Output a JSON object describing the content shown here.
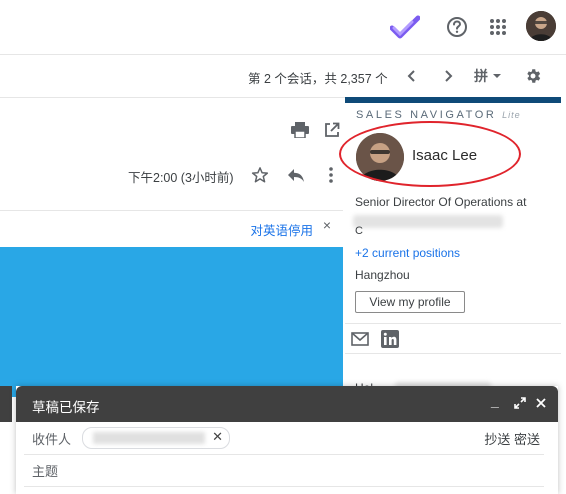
{
  "header": {
    "icons": [
      "tasks-check-icon",
      "help-icon",
      "apps-grid-icon",
      "account-avatar-icon"
    ]
  },
  "toolbar": {
    "count_text": "第 2 个会话，共 2,357 个",
    "input_tool_label": "拼"
  },
  "message": {
    "time_text": "下午2:00 (3小时前)",
    "translate_off_label": "对英语停用"
  },
  "sales_navigator": {
    "brand": "SALES NAVIGATOR",
    "tier": "Lite",
    "name": "Isaac Lee",
    "title_line": "Senior Director Of Operations at",
    "title_line2_suffix": "C",
    "positions_link": "+2 current positions",
    "location": "Hangzhou",
    "view_profile_label": "View my profile",
    "partial_section_label": "Hel",
    "colors": {
      "brand_bar": "#0e4a78",
      "highlight": "#e0242c"
    }
  },
  "compose": {
    "title": "草稿已保存",
    "to_label": "收件人",
    "cc_bcc_label": "抄送 密送",
    "subject_label": "主题",
    "colors": {
      "header_bg": "#404040"
    }
  },
  "content": {
    "colors": {
      "blue_block": "#29a7e6"
    }
  }
}
